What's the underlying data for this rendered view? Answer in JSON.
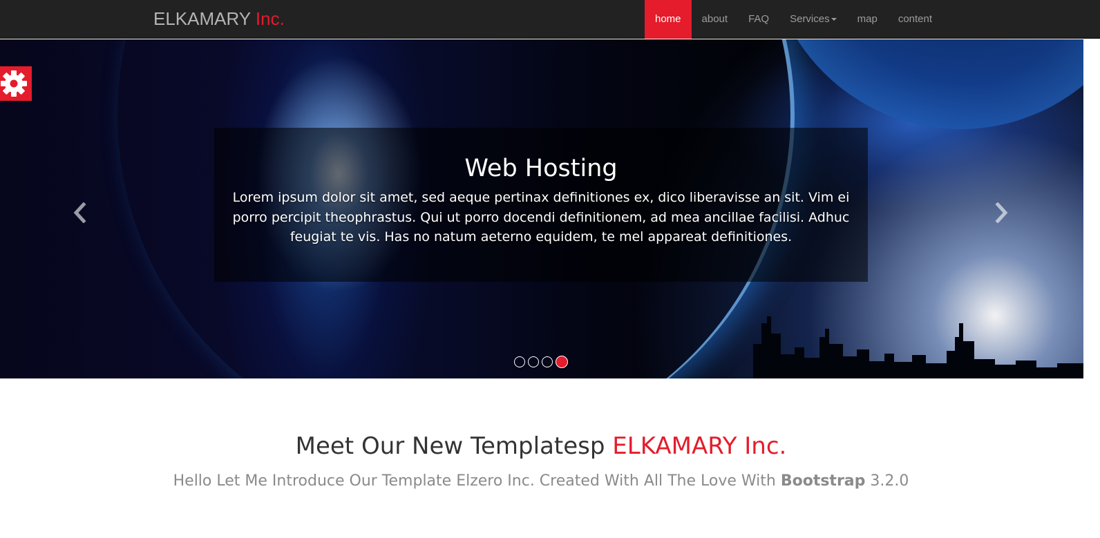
{
  "navbar": {
    "brand_main": "ELKAMARY",
    "brand_accent": "Inc.",
    "items": [
      {
        "label": "home",
        "active": true
      },
      {
        "label": "about"
      },
      {
        "label": "FAQ"
      },
      {
        "label": "Services"
      },
      {
        "label": "map"
      },
      {
        "label": "content"
      }
    ]
  },
  "carousel": {
    "caption_title": "Web Hosting",
    "caption_text": "Lorem ipsum dolor sit amet, sed aeque pertinax definitiones ex, dico liberavisse an sit. Vim ei porro percipit theophrastus. Qui ut porro docendi definitionem, ad mea ancillae facilisi. Adhuc feugiat te vis. Has no natum aeterno equidem, te mel appareat definitiones.",
    "prev_icon": "chevron-left-icon",
    "next_icon": "chevron-right-icon",
    "indicator_count": 4,
    "active_indicator": 4
  },
  "settings": {
    "icon": "gear-icon"
  },
  "intro": {
    "heading_main": "Meet Our New Templatesp",
    "heading_accent": "ELKAMARY Inc.",
    "subtitle_before": "Hello Let Me Introduce Our Template Elzero Inc. Created With All The Love With",
    "subtitle_bold": "Bootstrap",
    "subtitle_after": "3.2.0"
  },
  "colors": {
    "accent": "#e41c2c",
    "navbar_bg": "#222222",
    "nav_text": "#9d9d9d",
    "heading": "#333333",
    "subtitle": "#8a8a8a"
  }
}
